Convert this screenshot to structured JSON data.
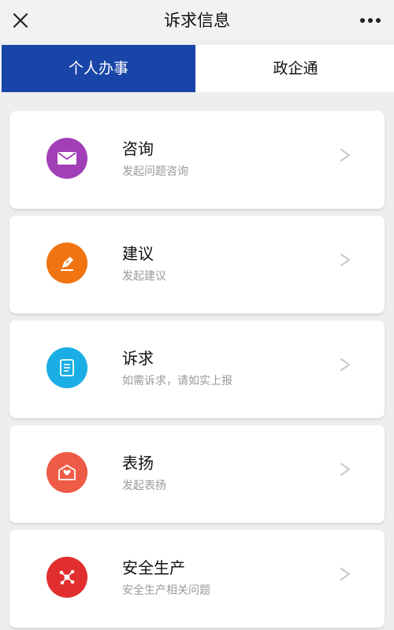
{
  "header": {
    "title": "诉求信息",
    "close_icon": "close-icon",
    "more_icon": "more-icon"
  },
  "tabs": [
    {
      "label": "个人办事",
      "active": true
    },
    {
      "label": "政企通",
      "active": false
    }
  ],
  "colors": {
    "active_tab": "#1a45a8",
    "consult": "#a13fb6",
    "suggest": "#f07412",
    "appeal": "#1aaee4",
    "praise": "#ee5b46",
    "safety": "#e12e2e"
  },
  "items": [
    {
      "title": "咨询",
      "subtitle": "发起问题咨询",
      "icon": "mail-icon",
      "color": "#a13fb6"
    },
    {
      "title": "建议",
      "subtitle": "发起建议",
      "icon": "pen-icon",
      "color": "#f07412"
    },
    {
      "title": "诉求",
      "subtitle": "如需诉求，请如实上报",
      "icon": "document-icon",
      "color": "#1aaee4"
    },
    {
      "title": "表扬",
      "subtitle": "发起表扬",
      "icon": "heart-letter-icon",
      "color": "#ee5b46"
    },
    {
      "title": "安全生产",
      "subtitle": "安全生产相关问题",
      "icon": "network-icon",
      "color": "#e12e2e"
    }
  ]
}
